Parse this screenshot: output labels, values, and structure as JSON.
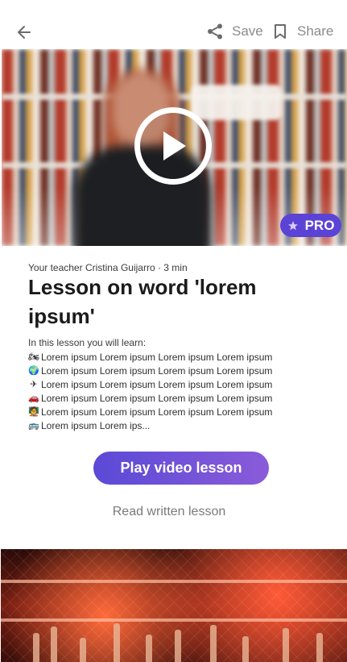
{
  "header": {
    "back_icon": "arrow-left-icon",
    "save_label": "Save",
    "save_icon": "share-nodes-icon",
    "share_label": "Share",
    "share_icon": "bookmark-icon"
  },
  "video": {
    "play_icon": "play-icon",
    "badge_icon": "star-icon",
    "badge_label": "PRO",
    "badge_color": "#5b43d6"
  },
  "lesson": {
    "meta": "Your teacher Cristina Guijarro · 3 min",
    "title": "Lesson on word 'lorem ipsum'",
    "learn_heading": "In this lesson you will learn:",
    "items": [
      {
        "emoji": "🏍",
        "icon": "motorcycle-emoji-icon",
        "text": "Lorem ipsum Lorem ipsum Lorem ipsum Lorem ipsum"
      },
      {
        "emoji": "🌍",
        "icon": "globe-emoji-icon",
        "text": "Lorem ipsum Lorem ipsum Lorem ipsum Lorem ipsum"
      },
      {
        "emoji": "✈",
        "icon": "airplane-emoji-icon",
        "text": "Lorem ipsum Lorem ipsum Lorem ipsum Lorem ipsum"
      },
      {
        "emoji": "🚗",
        "icon": "car-emoji-icon",
        "text": "Lorem ipsum Lorem ipsum Lorem ipsum Lorem ipsum"
      },
      {
        "emoji": "🧑‍🏫",
        "icon": "teacher-emoji-icon",
        "text": "Lorem ipsum Lorem ipsum Lorem ipsum Lorem ipsum"
      },
      {
        "emoji": "🚌",
        "icon": "bus-emoji-icon",
        "text": "Lorem ipsum Lorem ips..."
      }
    ]
  },
  "actions": {
    "play_label": "Play video lesson",
    "read_label": "Read written lesson",
    "accent_color": "#6a4fd8"
  }
}
